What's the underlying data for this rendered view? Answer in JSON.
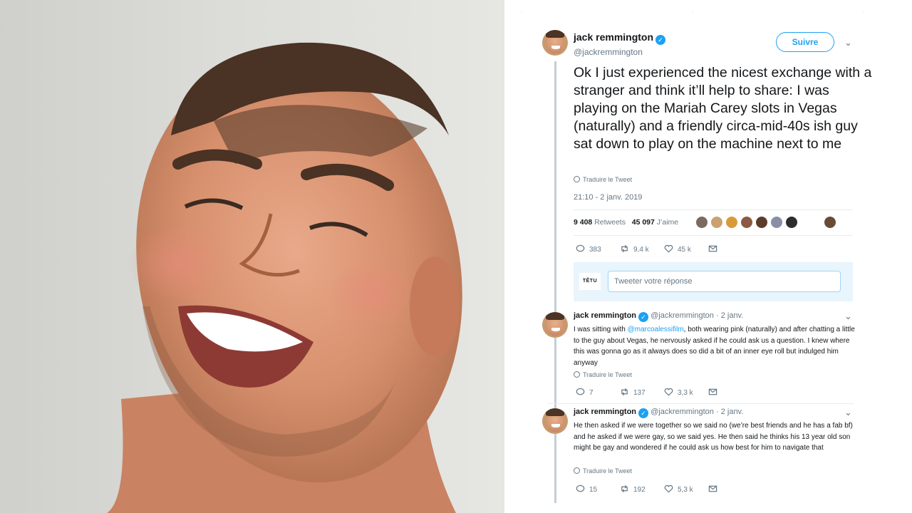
{
  "main_tweet": {
    "name": "jack remmington",
    "handle": "@jackremmington",
    "follow_label": "Suivre",
    "text": "Ok I just experienced the nicest exchange with a stranger and think it’ll help to share: I was playing on the Mariah Carey slots in Vegas (naturally) and a friendly circa-mid-40s ish guy sat down to play on the machine next to me",
    "translate_label": "Traduire le Tweet",
    "date": "21:10 - 2 janv. 2019",
    "retweets_count": "9 408",
    "retweets_label": "Retweets",
    "likes_count": "45 097",
    "likes_label": "J’aime",
    "replies": "383",
    "retweets_short": "9,4 k",
    "likes_short": "45 k"
  },
  "reply_box": {
    "brand": "TÊTU",
    "placeholder": "Tweeter votre réponse"
  },
  "thread": [
    {
      "name": "jack remmington",
      "handle": "@jackremmington",
      "dot": "·",
      "date": "2 janv.",
      "text_before": "I was sitting with ",
      "mention": "@marcoalessifilm",
      "text_after": ", both wearing pink (naturally) and after chatting a little to the guy about Vegas, he nervously asked if he could ask us a question. I knew where this was gonna go as it always does so did a bit of an inner eye roll but indulged him anyway",
      "translate_label": "Traduire le Tweet",
      "replies": "7",
      "retweets": "137",
      "likes": "3,3 k"
    },
    {
      "name": "jack remmington",
      "handle": "@jackremmington",
      "dot": "·",
      "date": "2 janv.",
      "text_before": "He then asked if we were together so we said no (we’re best friends and he has a fab bf) and he asked if we were gay, so we said yes. He then said he thinks his 13 year old son might be gay and wondered if he could ask us how best for him to navigate that",
      "mention": "",
      "text_after": "",
      "translate_label": "Traduire le Tweet",
      "replies": "15",
      "retweets": "192",
      "likes": "5,3 k"
    }
  ],
  "colors": {
    "accent": "#1da1f2",
    "muted": "#657786",
    "text": "#14171a",
    "reply_bg": "#e8f5fd"
  }
}
